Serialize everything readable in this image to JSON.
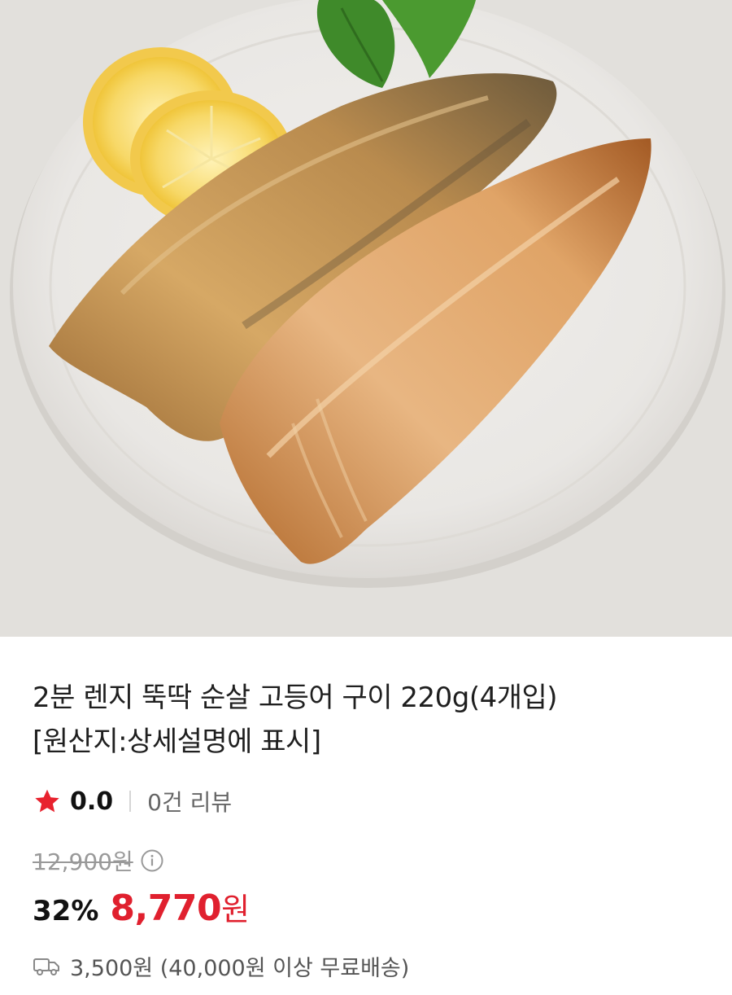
{
  "product": {
    "title_line1": "2분 렌지 뚝딱 순살 고등어 구이 220g(4개입)",
    "title_line2": "[원산지:상세설명에 표시]",
    "rating": "0.0",
    "review_count": "0건 리뷰",
    "original_price": "12,900원",
    "discount": "32%",
    "sale_price": "8,770",
    "sale_unit": "원",
    "shipping": "3,500원 (40,000원 이상 무료배송)"
  },
  "icons": {
    "rating_star": "star-icon",
    "price_info": "info-icon",
    "shipping": "truck-icon",
    "hero": "product-image"
  },
  "colors": {
    "accent_red": "#e0202e",
    "star": "#e8222e",
    "muted": "#999999"
  }
}
